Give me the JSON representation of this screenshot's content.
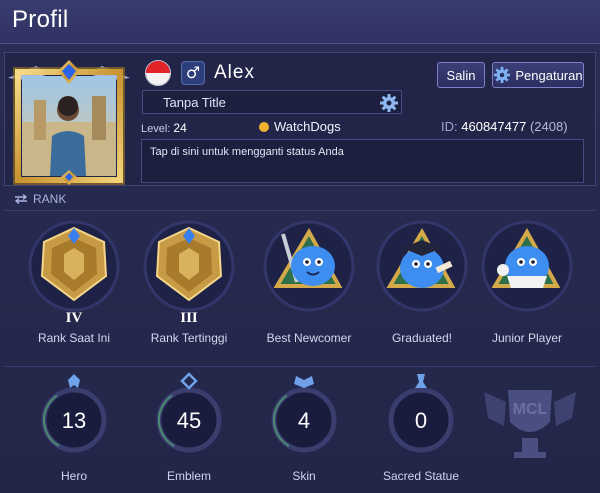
{
  "header": {
    "title": "Profil"
  },
  "profile": {
    "name": "Alex",
    "title_value": "Tanpa Title",
    "level_label": "Level:",
    "level_value": "24",
    "squad": "WatchDogs",
    "id_label": "ID:",
    "id_value": "460847477",
    "zone": "(2408)",
    "status_placeholder": "Tap di sini untuk mengganti status Anda",
    "gender_symbol": "♂"
  },
  "buttons": {
    "copy": "Salin",
    "settings": "Pengaturan"
  },
  "rank_section": {
    "label": "RANK"
  },
  "medals": [
    {
      "roman": "IV",
      "caption": "Rank Saat Ini"
    },
    {
      "roman": "III",
      "caption": "Rank Tertinggi"
    },
    {
      "caption": "Best Newcomer"
    },
    {
      "caption": "Graduated!"
    },
    {
      "caption": "Junior Player"
    }
  ],
  "stats": [
    {
      "value": "13",
      "label": "Hero"
    },
    {
      "value": "45",
      "label": "Emblem"
    },
    {
      "value": "4",
      "label": "Skin"
    },
    {
      "value": "0",
      "label": "Sacred Statue"
    }
  ],
  "mcl_badge": "MCL",
  "colors": {
    "background": "#272a4f",
    "accent_gold": "#d4a94a",
    "accent_blue": "#4fa0f5",
    "mascot_blue": "#3d8ef0",
    "flag_red": "#e2232a"
  }
}
